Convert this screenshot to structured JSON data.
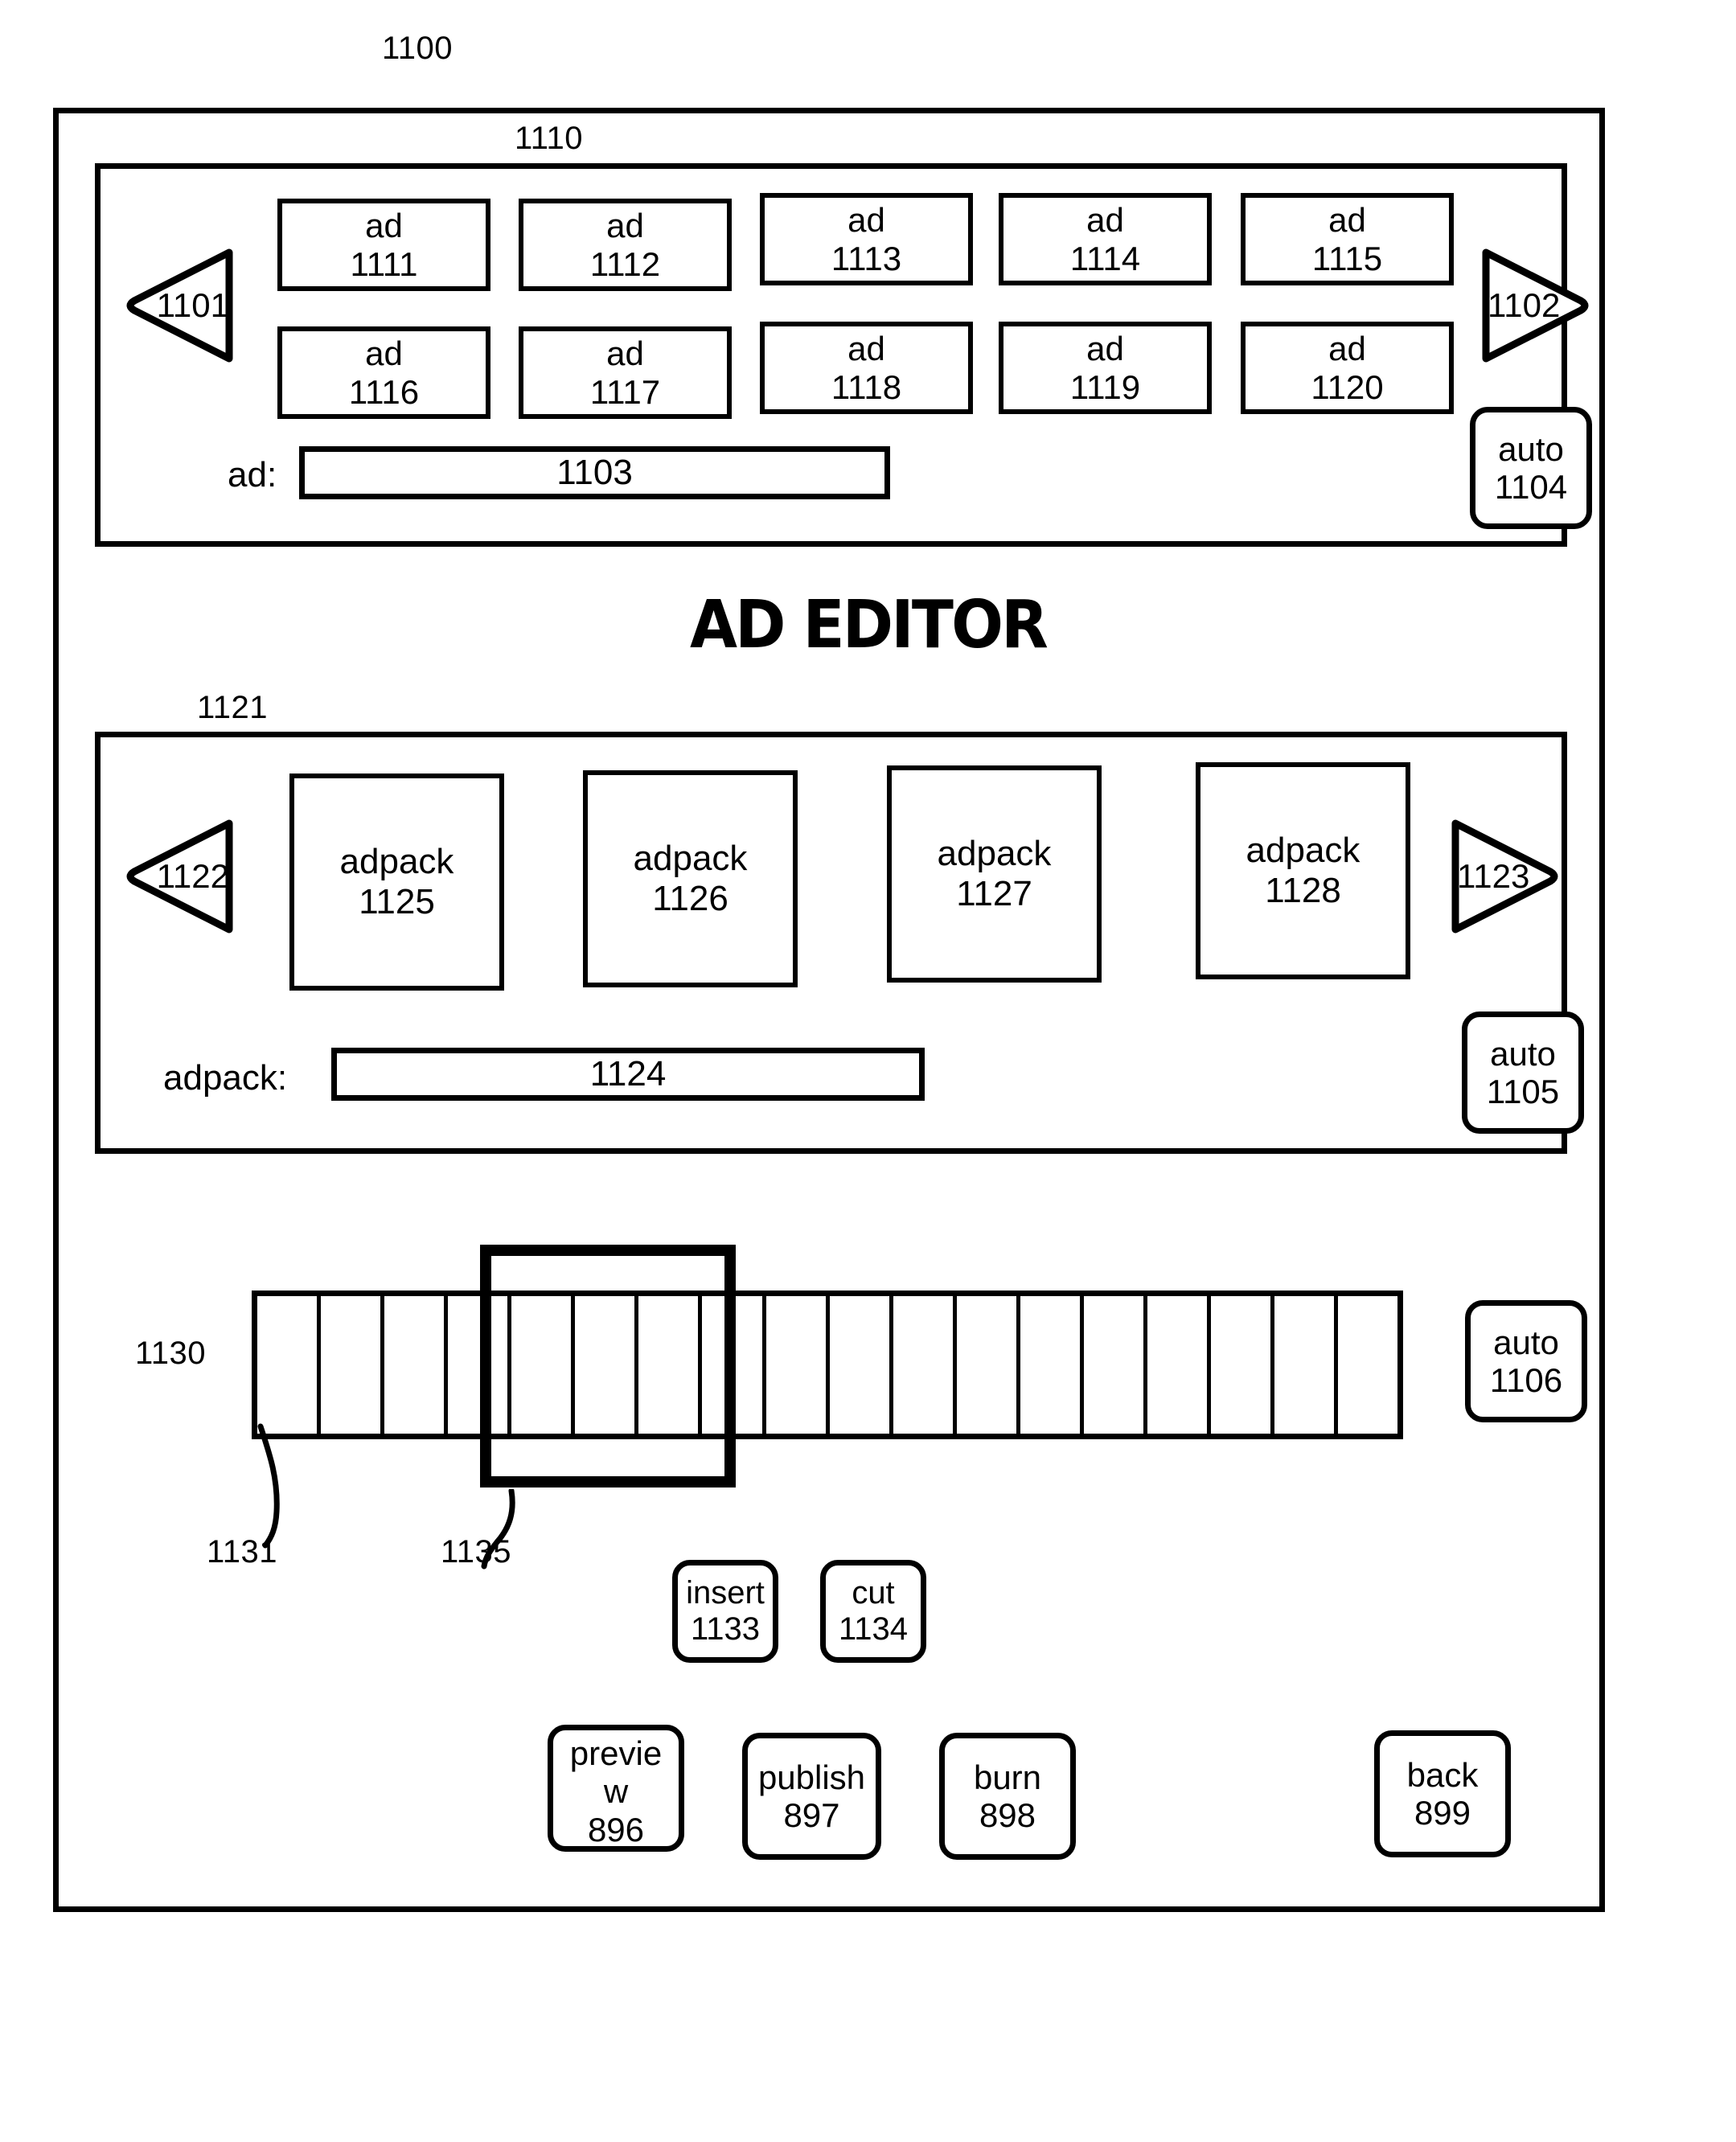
{
  "figure": {
    "device_ref": "1100",
    "title": "AD EDITOR"
  },
  "ad_panel": {
    "ref": "1110",
    "prev_button": "1101",
    "next_button": "1102",
    "auto_button": {
      "label": "auto",
      "ref": "1104"
    },
    "field": {
      "label": "ad:",
      "value": "1103"
    },
    "tiles": [
      {
        "label": "ad",
        "ref": "1111"
      },
      {
        "label": "ad",
        "ref": "1112"
      },
      {
        "label": "ad",
        "ref": "1113"
      },
      {
        "label": "ad",
        "ref": "1114"
      },
      {
        "label": "ad",
        "ref": "1115"
      },
      {
        "label": "ad",
        "ref": "1116"
      },
      {
        "label": "ad",
        "ref": "1117"
      },
      {
        "label": "ad",
        "ref": "1118"
      },
      {
        "label": "ad",
        "ref": "1119"
      },
      {
        "label": "ad",
        "ref": "1120"
      }
    ]
  },
  "adpack_panel": {
    "ref": "1121",
    "prev_button": "1122",
    "next_button": "1123",
    "auto_button": {
      "label": "auto",
      "ref": "1105"
    },
    "field": {
      "label": "adpack:",
      "value": "1124"
    },
    "tiles": [
      {
        "label": "adpack",
        "ref": "1125"
      },
      {
        "label": "adpack",
        "ref": "1126"
      },
      {
        "label": "adpack",
        "ref": "1127"
      },
      {
        "label": "adpack",
        "ref": "1128"
      }
    ]
  },
  "timeline": {
    "ref": "1130",
    "cell_ref": "1131",
    "selection_ref": "1135",
    "cell_count": 18,
    "selection_start_cell": 5,
    "selection_end_cell": 8,
    "auto_button": {
      "label": "auto",
      "ref": "1106"
    }
  },
  "edit_buttons": [
    {
      "label": "insert",
      "ref": "1133"
    },
    {
      "label": "cut",
      "ref": "1134"
    }
  ],
  "action_buttons": [
    {
      "label_part1": "previe",
      "label_part2": "w",
      "ref": "896"
    },
    {
      "label": "publish",
      "ref": "897"
    },
    {
      "label": "burn",
      "ref": "898"
    },
    {
      "label": "back",
      "ref": "899"
    }
  ],
  "colors": {
    "ink": "#000000",
    "paper": "#ffffff"
  }
}
